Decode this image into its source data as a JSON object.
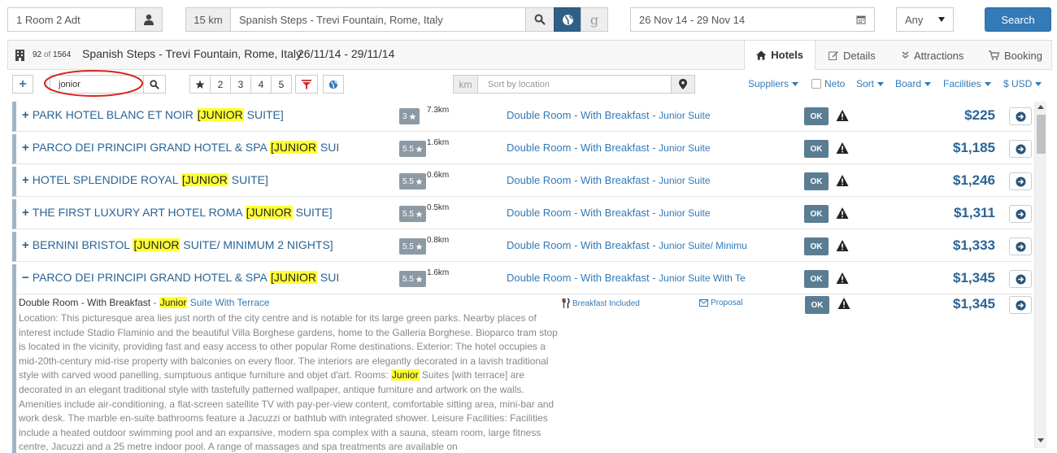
{
  "search": {
    "rooms_value": "1 Room 2 Adt",
    "radius": "15 km",
    "location_value": "Spanish Steps - Trevi Fountain, Rome, Italy",
    "google_label": "g",
    "dates_value": "26 Nov 14 - 29 Nov 14",
    "stars_select": "Any",
    "search_label": "Search"
  },
  "header": {
    "count_current": "92",
    "count_of": "of",
    "count_total": "1564",
    "location": "Spanish Steps - Trevi Fountain, Rome, Italy",
    "dates": "26/11/14 - 29/11/14",
    "tabs": [
      {
        "label": "Hotels",
        "icon": "home-icon"
      },
      {
        "label": "Details",
        "icon": "edit-icon"
      },
      {
        "label": "Attractions",
        "icon": "chevrons-down-icon"
      },
      {
        "label": "Booking",
        "icon": "cart-icon"
      }
    ]
  },
  "filters": {
    "plus_label": "+",
    "name_filter_value": "jonior",
    "star_buttons": [
      "2",
      "3",
      "4",
      "5"
    ],
    "km_label": "km",
    "sort_location_placeholder": "Sort by location",
    "suppliers": "Suppliers",
    "neto": "Neto",
    "sort": "Sort",
    "board": "Board",
    "facilities": "Facilities",
    "currency": "$ USD"
  },
  "hotels": [
    {
      "name": "PARK HOTEL BLANC ET NOIR",
      "hl": "[JUNIOR",
      "rest": " SUITE]",
      "stars": "3",
      "dist": "7.3km",
      "room": "Double Room - With Breakfast",
      "room_sep": " - ",
      "room_sub": "Junior Suite",
      "status": "OK",
      "price": "$225",
      "toggle": "+"
    },
    {
      "name": "PARCO DEI PRINCIPI GRAND HOTEL & SPA",
      "hl": "[JUNIOR",
      "rest": " SUIT",
      "stars": "5.5",
      "dist": "1.6km",
      "room": "Double Room - With Breakfast",
      "room_sep": " - ",
      "room_sub": "Junior Suite",
      "status": "OK",
      "price": "$1,185",
      "toggle": "+"
    },
    {
      "name": "HOTEL SPLENDIDE ROYAL",
      "hl": "[JUNIOR",
      "rest": " SUITE]",
      "stars": "5.5",
      "dist": "0.6km",
      "room": "Double Room - With Breakfast",
      "room_sep": " - ",
      "room_sub": "Junior Suite",
      "status": "OK",
      "price": "$1,246",
      "toggle": "+"
    },
    {
      "name": "THE FIRST LUXURY ART HOTEL ROMA",
      "hl": "[JUNIOR",
      "rest": " SUITE]",
      "stars": "5.5",
      "dist": "0.5km",
      "room": "Double Room - With Breakfast",
      "room_sep": " - ",
      "room_sub": "Junior Suite",
      "status": "OK",
      "price": "$1,311",
      "toggle": "+"
    },
    {
      "name": "BERNINI BRISTOL",
      "hl": "[JUNIOR",
      "rest": " SUITE/ MINIMUM 2 NIGHTS]",
      "stars": "5.5",
      "dist": "0.8km",
      "room": "Double Room - With Breakfast",
      "room_sep": " - ",
      "room_sub": "Junior Suite/ Minimu",
      "status": "OK",
      "price": "$1,333",
      "toggle": "+"
    },
    {
      "name": "PARCO DEI PRINCIPI GRAND HOTEL & SPA",
      "hl": "[JUNIOR",
      "rest": " SUIT",
      "stars": "5.5",
      "dist": "1.6km",
      "room": "Double Room - With Breakfast",
      "room_sep": " - ",
      "room_sub": "Junior Suite With Te",
      "status": "OK",
      "price": "$1,345",
      "toggle": "−"
    }
  ],
  "detail": {
    "room": "Double Room - With Breakfast",
    "sep": " - ",
    "hl": "Junior",
    "sub": " Suite With Terrace",
    "breakfast": "Breakfast Included",
    "proposal": "Proposal",
    "status": "OK",
    "price": "$1,345",
    "desc_1": "Location: This picturesque area lies just north of the city centre and is notable for its large green parks. Nearby places of interest include Stadio Flaminio and the beautiful Villa Borghese gardens, home to the Galleria Borghese. Bioparco tram stop is located in the vicinity, providing fast and easy access to other popular Rome destinations. Exterior: The hotel occupies a mid-20th-century mid-rise property with balconies on every floor. The interiors are elegantly decorated in a lavish traditional style with carved wood panelling, sumptuous antique furniture and objet d'art. Rooms: ",
    "desc_hl": "Junior",
    "desc_2": " Suites [with terrace] are decorated in an elegant traditional style with tastefully patterned wallpaper, antique furniture and artwork on the walls. Amenities include air-conditioning, a flat-screen satellite TV with pay-per-view content, comfortable sitting area, mini-bar and work desk. The marble en-suite bathrooms feature a Jacuzzi or bathtub with integrated shower. Leisure Facilities: Facilities include a heated outdoor swimming pool and an expansive, modern spa complex with a sauna, steam room, large fitness centre, Jacuzzi and a 25 metre indoor pool. A range of massages and spa treatments are available on"
  },
  "colors": {
    "primary": "#337ab7",
    "highlight": "#ffff33",
    "annotation": "#d9231d",
    "ok_badge": "#5a7d94"
  }
}
